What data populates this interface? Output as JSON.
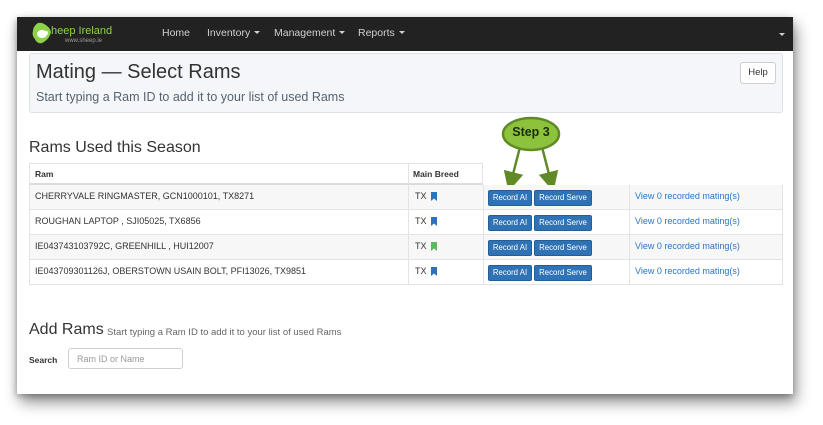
{
  "navbar": {
    "brand_text": "heep Ireland",
    "brand_sub": "www.sheep.ie",
    "items": [
      {
        "label": "Home",
        "dropdown": false
      },
      {
        "label": "Inventory",
        "dropdown": true
      },
      {
        "label": "Management",
        "dropdown": true
      },
      {
        "label": "Reports",
        "dropdown": true
      }
    ]
  },
  "header": {
    "title": "Mating — Select Rams",
    "subtitle": "Start typing a Ram ID to add it to your list of used Rams",
    "help_label": "Help"
  },
  "used_rams": {
    "title": "Rams Used this Season",
    "columns": [
      "Ram",
      "Main Breed"
    ],
    "rows": [
      {
        "ram": "CHERRYVALE RINGMASTER, GCN1000101, TX8271",
        "breed": "TX",
        "breed_color": "#2f73b6",
        "record_ai": "Record AI",
        "record_serve": "Record Serve",
        "matings": "View 0 recorded mating(s)"
      },
      {
        "ram": "ROUGHAN LAPTOP , SJI05025, TX6856",
        "breed": "TX",
        "breed_color": "#2f73b6",
        "record_ai": "Record AI",
        "record_serve": "Record Serve",
        "matings": "View 0 recorded mating(s)"
      },
      {
        "ram": "IE043743103792C, GREENHILL , HUI12007",
        "breed": "TX",
        "breed_color": "#5cb85c",
        "record_ai": "Record AI",
        "record_serve": "Record Serve",
        "matings": "View 0 recorded mating(s)"
      },
      {
        "ram": "IE043709301126J, OBERSTOWN USAIN BOLT, PFI13026, TX9851",
        "breed": "TX",
        "breed_color": "#2f73b6",
        "record_ai": "Record AI",
        "record_serve": "Record Serve",
        "matings": "View 0 recorded mating(s)"
      }
    ]
  },
  "annotation": {
    "label": "Step 3",
    "fill_color": "#8dc23d",
    "stroke_color": "#5f8a26"
  },
  "add_rams": {
    "title": "Add Rams",
    "subtitle": "Start typing a Ram ID to add it to your list of used Rams",
    "search_label": "Search",
    "search_placeholder": "Ram ID or Name",
    "search_value": ""
  },
  "colors": {
    "navbar_bg": "#222222",
    "primary_button": "#2f73b6",
    "link": "#2a76c6"
  }
}
